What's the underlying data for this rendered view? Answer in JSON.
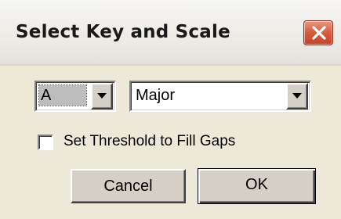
{
  "window": {
    "title": "Select Key and Scale"
  },
  "key_select": {
    "selected": "A"
  },
  "scale_select": {
    "selected": "Major"
  },
  "threshold_checkbox": {
    "label": "Set Threshold to Fill Gaps",
    "checked": false
  },
  "buttons": {
    "cancel_label": "Cancel",
    "ok_label": "OK"
  },
  "colors": {
    "face": "#ece9d8",
    "close_button": "#d6603f",
    "selection": "#bdbdbd"
  },
  "icons": {
    "close": "close-icon",
    "dropdown": "chevron-down-icon"
  }
}
